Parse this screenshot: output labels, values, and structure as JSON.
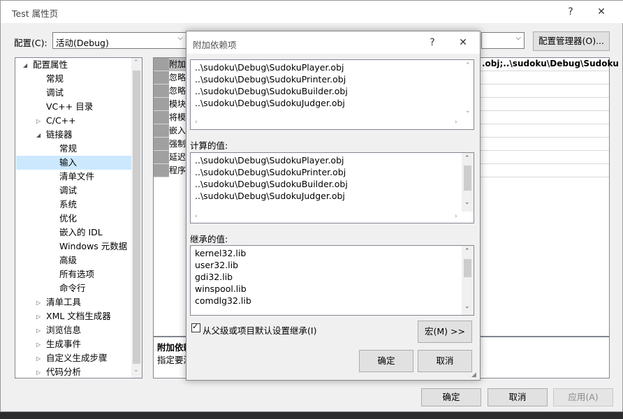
{
  "window": {
    "title": "Test 属性页",
    "help": "?",
    "close": "✕"
  },
  "toolbar": {
    "config_label": "配置(C):",
    "config_value": "活动(Debug)",
    "config_manager": "配置管理器(O)..."
  },
  "tree": {
    "items": [
      {
        "label": "配置属性",
        "level": 0,
        "arrow": "◢",
        "selected": false
      },
      {
        "label": "常规",
        "level": 1,
        "arrow": "",
        "selected": false
      },
      {
        "label": "调试",
        "level": 1,
        "arrow": "",
        "selected": false
      },
      {
        "label": "VC++ 目录",
        "level": 1,
        "arrow": "",
        "selected": false
      },
      {
        "label": "C/C++",
        "level": 1,
        "arrow": "▷",
        "selected": false
      },
      {
        "label": "链接器",
        "level": 1,
        "arrow": "◢",
        "selected": false
      },
      {
        "label": "常规",
        "level": 2,
        "arrow": "",
        "selected": false
      },
      {
        "label": "输入",
        "level": 2,
        "arrow": "",
        "selected": true
      },
      {
        "label": "清单文件",
        "level": 2,
        "arrow": "",
        "selected": false
      },
      {
        "label": "调试",
        "level": 2,
        "arrow": "",
        "selected": false
      },
      {
        "label": "系统",
        "level": 2,
        "arrow": "",
        "selected": false
      },
      {
        "label": "优化",
        "level": 2,
        "arrow": "",
        "selected": false
      },
      {
        "label": "嵌入的 IDL",
        "level": 2,
        "arrow": "",
        "selected": false
      },
      {
        "label": "Windows 元数据",
        "level": 2,
        "arrow": "",
        "selected": false
      },
      {
        "label": "高级",
        "level": 2,
        "arrow": "",
        "selected": false
      },
      {
        "label": "所有选项",
        "level": 2,
        "arrow": "",
        "selected": false
      },
      {
        "label": "命令行",
        "level": 2,
        "arrow": "",
        "selected": false
      },
      {
        "label": "清单工具",
        "level": 1,
        "arrow": "▷",
        "selected": false
      },
      {
        "label": "XML 文档生成器",
        "level": 1,
        "arrow": "▷",
        "selected": false
      },
      {
        "label": "浏览信息",
        "level": 1,
        "arrow": "▷",
        "selected": false
      },
      {
        "label": "生成事件",
        "level": 1,
        "arrow": "▷",
        "selected": false
      },
      {
        "label": "自定义生成步骤",
        "level": 1,
        "arrow": "▷",
        "selected": false
      },
      {
        "label": "代码分析",
        "level": 1,
        "arrow": "▷",
        "selected": false
      }
    ]
  },
  "grid": {
    "rows": [
      {
        "key": "附加",
        "value": ".obj;..\\sudoku\\Debug\\Sudoku"
      },
      {
        "key": "忽略",
        "value": ""
      },
      {
        "key": "忽略",
        "value": ""
      },
      {
        "key": "模块",
        "value": ""
      },
      {
        "key": "将模",
        "value": ""
      },
      {
        "key": "嵌入",
        "value": ""
      },
      {
        "key": "强制",
        "value": ""
      },
      {
        "key": "延迟",
        "value": ""
      },
      {
        "key": "程序",
        "value": ""
      }
    ],
    "desc_title": "附加依赖",
    "desc_text": "指定要添"
  },
  "footer": {
    "ok": "确定",
    "cancel": "取消",
    "apply": "应用(A)"
  },
  "dialog": {
    "title": "附加依赖项",
    "help": "?",
    "close": "✕",
    "edit_items": [
      "..\\sudoku\\Debug\\SudokuPlayer.obj",
      "..\\sudoku\\Debug\\SudokuPrinter.obj",
      "..\\sudoku\\Debug\\SudokuBuilder.obj",
      "..\\sudoku\\Debug\\SudokuJudger.obj"
    ],
    "computed_label": "计算的值:",
    "computed_items": [
      "..\\sudoku\\Debug\\SudokuPlayer.obj",
      "..\\sudoku\\Debug\\SudokuPrinter.obj",
      "..\\sudoku\\Debug\\SudokuBuilder.obj",
      "..\\sudoku\\Debug\\SudokuJudger.obj"
    ],
    "inherited_label": "继承的值:",
    "inherited_items": [
      "kernel32.lib",
      "user32.lib",
      "gdi32.lib",
      "winspool.lib",
      "comdlg32.lib"
    ],
    "inherit_checkbox": "从父级或项目默认设置继承(I)",
    "inherit_checked": true,
    "macro_button": "宏(M) >>",
    "ok": "确定",
    "cancel": "取消"
  }
}
